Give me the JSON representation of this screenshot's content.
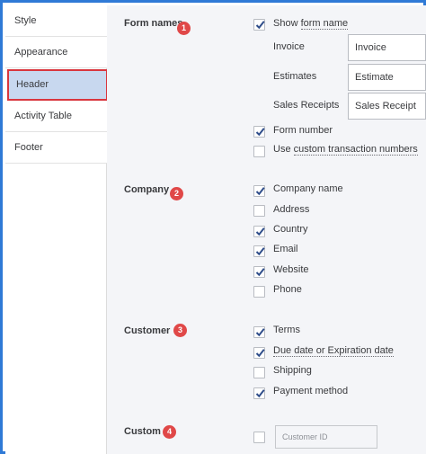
{
  "sidebar": {
    "items": [
      {
        "label": "Style"
      },
      {
        "label": "Appearance"
      },
      {
        "label": "Header"
      },
      {
        "label": "Activity Table"
      },
      {
        "label": "Footer"
      }
    ],
    "active": "Header"
  },
  "sections": {
    "form_names": {
      "title": "Form names",
      "badge": "1",
      "show_form_name": {
        "prefix": "Show ",
        "link": "form name",
        "checked": true
      },
      "fields": [
        {
          "label": "Invoice",
          "value": "Invoice"
        },
        {
          "label": "Estimates",
          "value": "Estimate"
        },
        {
          "label": "Sales Receipts",
          "value": "Sales Receipt"
        }
      ],
      "form_number": {
        "label": "Form number",
        "checked": true
      },
      "custom_numbers": {
        "prefix": "Use ",
        "link": "custom transaction numbers",
        "checked": false
      }
    },
    "company": {
      "title": "Company",
      "badge": "2",
      "options": [
        {
          "label": "Company name",
          "checked": true
        },
        {
          "label": "Address",
          "checked": false
        },
        {
          "label": "Country",
          "checked": true
        },
        {
          "label": "Email",
          "checked": true
        },
        {
          "label": "Website",
          "checked": true
        },
        {
          "label": "Phone",
          "checked": false
        }
      ]
    },
    "customer": {
      "title": "Customer",
      "badge": "3",
      "options": [
        {
          "label": "Terms",
          "checked": true
        },
        {
          "label": "Due date or Expiration date",
          "checked": true
        },
        {
          "label": "Shipping",
          "checked": false
        },
        {
          "label": "Payment method",
          "checked": true
        }
      ]
    },
    "custom": {
      "title": "Custom",
      "badge": "4",
      "checked": false,
      "placeholder": "Customer ID"
    }
  },
  "colors": {
    "frame_border": "#2f7ad6",
    "active_highlight": "#c8d8ef",
    "active_border": "#d9363e",
    "badge": "#e04848",
    "checkmark": "#2f4d8a",
    "panel_bg": "#f4f5f8"
  }
}
